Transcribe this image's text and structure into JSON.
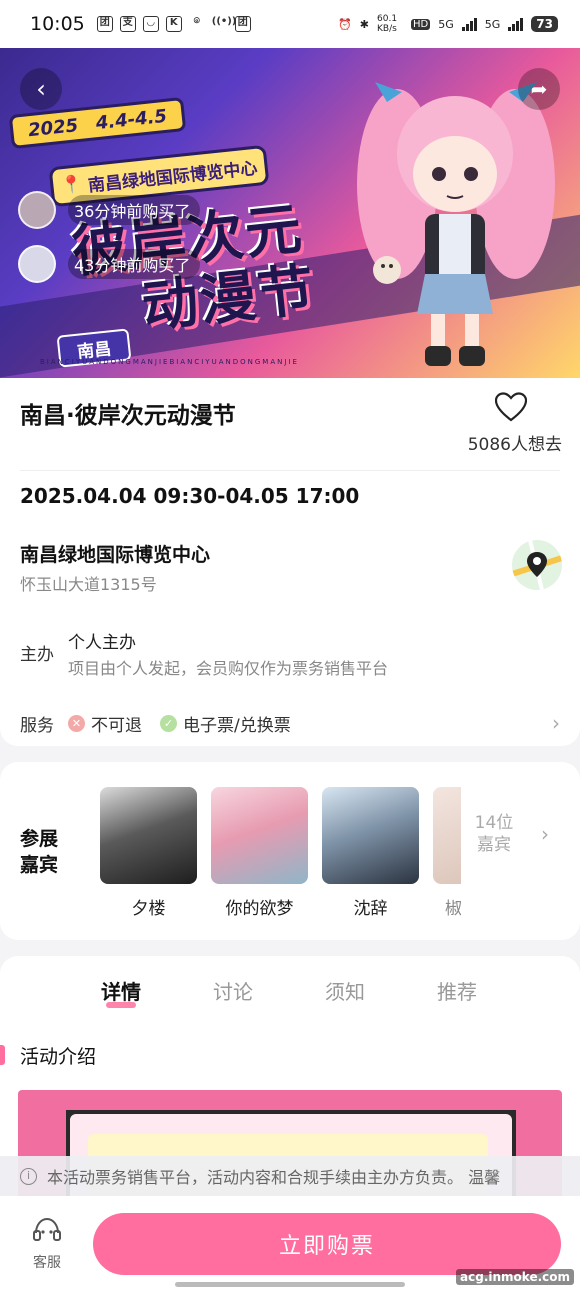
{
  "status_bar": {
    "time": "10:05",
    "net_speed": "60.1 KB/s",
    "hd": "HD",
    "sim1": "5G",
    "sim2": "5G",
    "battery": "73"
  },
  "banner": {
    "year": "2025",
    "date_range": "4.4-4.5",
    "venue_tag": "南昌绿地国际博览中心",
    "title_line1": "彼岸次元",
    "title_line2": "动漫节",
    "city": "南昌",
    "bottom_text": "BIANCIYUANDONGMANJIEBIANCIYUANDONGMANJIE",
    "recent_purchases": [
      {
        "text": "36分钟前购买了"
      },
      {
        "text": "43分钟前购买了"
      }
    ]
  },
  "event": {
    "title": "南昌·彼岸次元动漫节",
    "want_count": "5086人想去",
    "time": "2025.04.04 09:30-04.05 17:00",
    "venue": "南昌绿地国际博览中心",
    "address": "怀玉山大道1315号",
    "organizer_label": "主办",
    "organizer_name": "个人主办",
    "organizer_desc": "项目由个人发起，会员购仅作为票务销售平台",
    "service_label": "服务",
    "services": [
      {
        "label": "不可退",
        "status": "no"
      },
      {
        "label": "电子票/兑换票",
        "status": "yes"
      }
    ]
  },
  "guests": {
    "title": "参展嘉宾",
    "items": [
      {
        "name": "夕楼"
      },
      {
        "name": "你的欲梦"
      },
      {
        "name": "沈辞"
      },
      {
        "name": "椒"
      }
    ],
    "more": "14位嘉宾"
  },
  "tabs": [
    {
      "label": "详情",
      "active": true
    },
    {
      "label": "讨论",
      "active": false
    },
    {
      "label": "须知",
      "active": false
    },
    {
      "label": "推荐",
      "active": false
    }
  ],
  "section": {
    "title": "活动介绍"
  },
  "notice": {
    "text": "本活动票务销售平台，活动内容和合规手续由主办方负责。 温馨"
  },
  "bottom_bar": {
    "service_label": "客服",
    "buy_label": "立即购票",
    "watermark": "acg.inmoke.com"
  },
  "colors": {
    "accent": "#ff6e9e",
    "refund_no": "#f4a9a9",
    "eticket_yes": "#b6e0a0"
  }
}
